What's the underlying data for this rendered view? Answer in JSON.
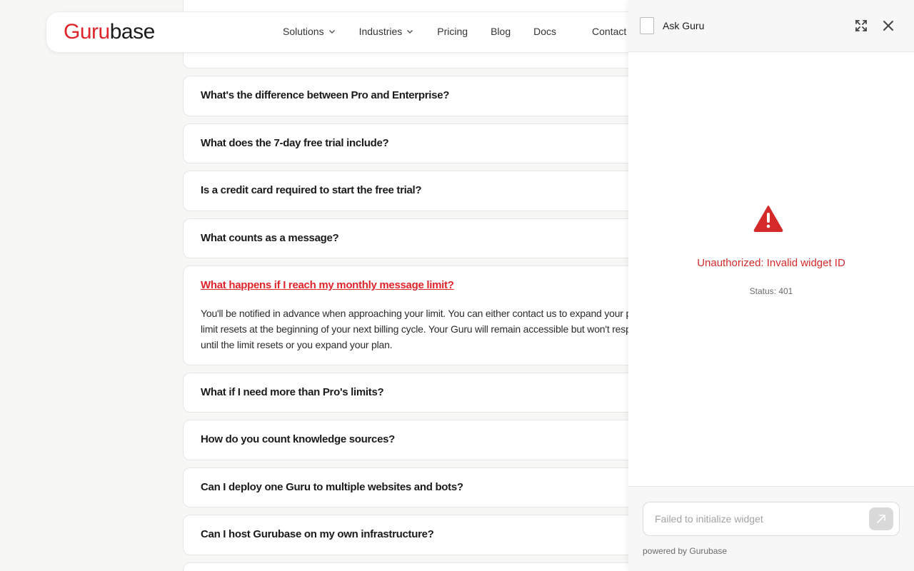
{
  "nav": {
    "logo_part1": "Guru",
    "logo_part2": "base",
    "items": [
      {
        "label": "Solutions",
        "dropdown": true
      },
      {
        "label": "Industries",
        "dropdown": true
      },
      {
        "label": "Pricing"
      },
      {
        "label": "Blog"
      },
      {
        "label": "Docs"
      },
      {
        "label": "Contact"
      }
    ]
  },
  "faq": [
    {
      "q": "What's the difference between Pro and Enterprise?"
    },
    {
      "q": "What does the 7-day free trial include?"
    },
    {
      "q": "Is a credit card required to start the free trial?"
    },
    {
      "q": "What counts as a message?"
    },
    {
      "q": "What happens if I reach my monthly message limit?",
      "a1": "You'll be notified in advance when approaching your limit. You can either contact us to expand your plan",
      "a2": "limit resets at the beginning of your next billing cycle. Your Guru will remain accessible but won't respon",
      "a3": "until the limit resets or you expand your plan."
    },
    {
      "q": "What if I need more than Pro's limits?"
    },
    {
      "q": "How do you count knowledge sources?"
    },
    {
      "q": "Can I deploy one Guru to multiple websites and bots?"
    },
    {
      "q": "Can I host Gurubase on my own infrastructure?"
    }
  ],
  "widget": {
    "title": "Ask Guru",
    "error": "Unauthorized: Invalid widget ID",
    "status": "Status: 401",
    "input_placeholder": "Failed to initialize widget",
    "powered": "powered by Gurubase"
  },
  "colors": {
    "brand_red": "#e0242b",
    "error_red": "#d42a2a"
  },
  "icons": [
    "chevron-down-icon",
    "expand-icon",
    "close-icon",
    "warning-icon",
    "send-arrow-icon",
    "broken-image-icon"
  ]
}
